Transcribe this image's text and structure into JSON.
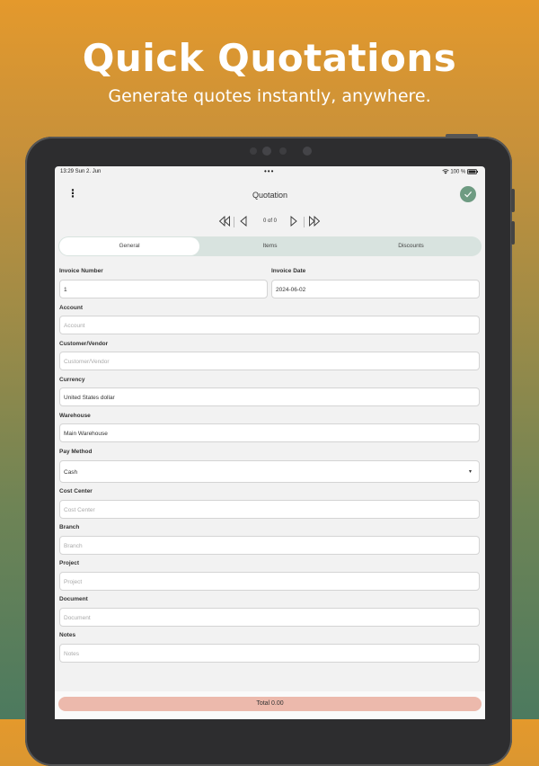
{
  "promo": {
    "headline": "Quick Quotations",
    "subline": "Generate quotes instantly, anywhere."
  },
  "status_bar": {
    "time": "13:29  Sun 2. Jun",
    "battery": "100 %"
  },
  "app_bar": {
    "title": "Quotation",
    "menu_icon": "kebab-menu-icon",
    "confirm_icon": "check-icon",
    "accent": "#6e9b82"
  },
  "pager": {
    "count": "0 of 0"
  },
  "tabs": [
    {
      "label": "General",
      "active": true
    },
    {
      "label": "Items",
      "active": false
    },
    {
      "label": "Discounts",
      "active": false
    }
  ],
  "form": {
    "invoice_number": {
      "label": "Invoice Number",
      "value": "1"
    },
    "invoice_date": {
      "label": "Invoice Date",
      "value": "2024-06-02"
    },
    "account": {
      "label": "Account",
      "placeholder": "Account"
    },
    "customer_vendor": {
      "label": "Customer/Vendor",
      "placeholder": "Customer/Vendor"
    },
    "currency": {
      "label": "Currency",
      "value": "United States dollar"
    },
    "warehouse": {
      "label": "Warehouse",
      "value": "Main Warehouse"
    },
    "pay_method": {
      "label": "Pay Method",
      "value": "Cash"
    },
    "cost_center": {
      "label": "Cost Center",
      "placeholder": "Cost Center"
    },
    "branch": {
      "label": "Branch",
      "placeholder": "Branch"
    },
    "project": {
      "label": "Project",
      "placeholder": "Project"
    },
    "document": {
      "label": "Document",
      "placeholder": "Document"
    },
    "notes": {
      "label": "Notes",
      "placeholder": "Notes"
    }
  },
  "footer": {
    "total": "Total 0.00",
    "total_color": "#ecb9ac"
  }
}
